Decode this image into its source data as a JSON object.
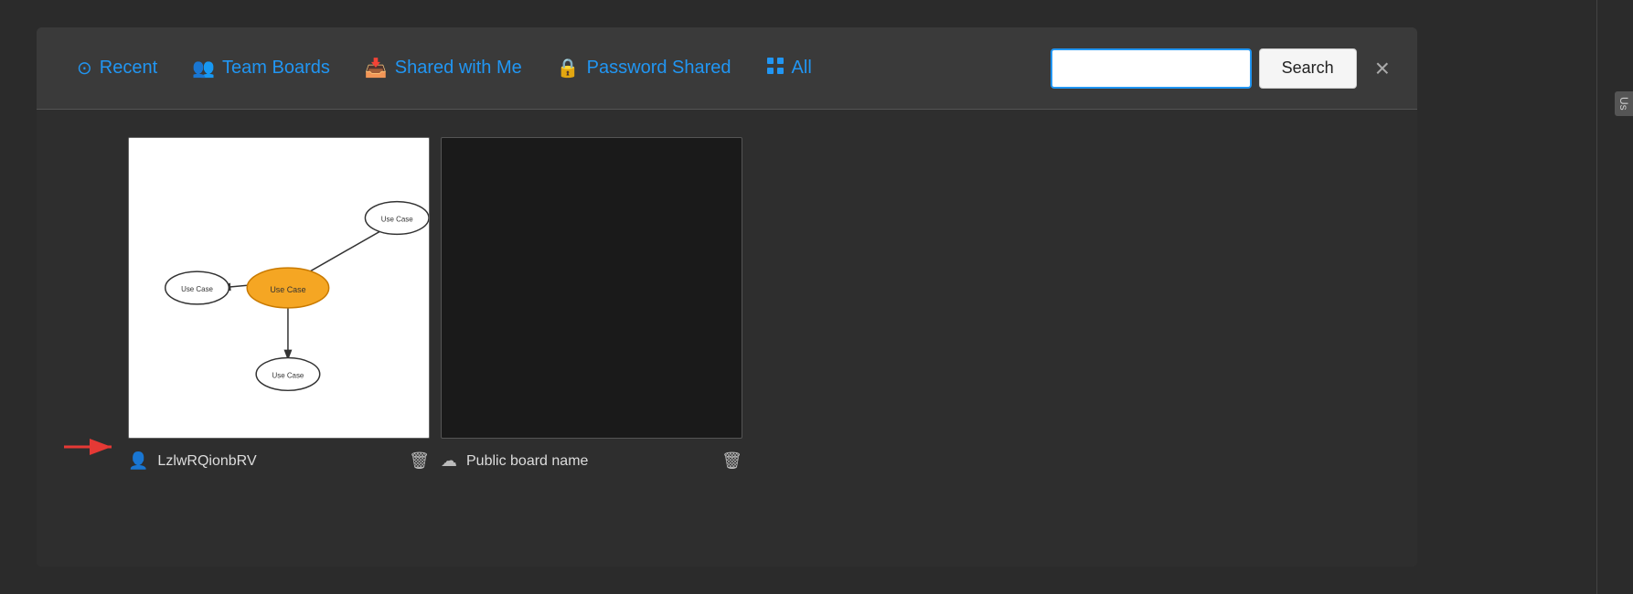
{
  "nav": {
    "items": [
      {
        "id": "recent",
        "label": "Recent",
        "icon": "🕐",
        "active": false
      },
      {
        "id": "team-boards",
        "label": "Team Boards",
        "icon": "👥",
        "active": false
      },
      {
        "id": "shared-with-me",
        "label": "Shared with Me",
        "icon": "📥",
        "active": false
      },
      {
        "id": "password-shared",
        "label": "Password Shared",
        "icon": "🔒",
        "active": false
      },
      {
        "id": "all",
        "label": "All",
        "icon": "⊞",
        "active": false
      }
    ],
    "search_placeholder": "",
    "search_label": "Search",
    "close_label": "×"
  },
  "boards": [
    {
      "id": "board-1",
      "name": "LzlwRQionbRV",
      "name_icon": "👤",
      "has_arrow": true,
      "delete_icon": "🗑",
      "type": "diagram"
    },
    {
      "id": "board-2",
      "name": "Public board name",
      "name_icon": "☁",
      "has_arrow": false,
      "delete_icon": "🗑",
      "type": "empty"
    }
  ],
  "colors": {
    "accent_blue": "#2196f3",
    "background_dark": "#2e2e2e",
    "panel_bg": "#3a3a3a",
    "text_light": "#dddddd",
    "border": "#555555"
  }
}
